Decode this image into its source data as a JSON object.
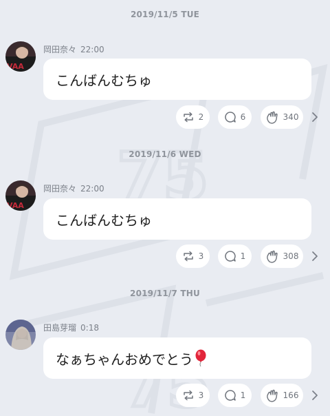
{
  "colors": {
    "background": "#e9ecf2",
    "bubble": "#ffffff",
    "meta_text": "#8f949c"
  },
  "posts": [
    {
      "date": "2019/11/5 TUE",
      "author": "岡田奈々",
      "time": "22:00",
      "avatar": "avatar-photo-okada",
      "message": "こんばんむちゅ",
      "reposts": "2",
      "comments": "6",
      "claps": "340"
    },
    {
      "date": "2019/11/6 WED",
      "author": "岡田奈々",
      "time": "22:00",
      "avatar": "avatar-photo-okada",
      "message": "こんばんむちゅ",
      "reposts": "3",
      "comments": "1",
      "claps": "308"
    },
    {
      "date": "2019/11/7 THU",
      "author": "田島芽瑠",
      "time": "0:18",
      "avatar": "avatar-photo-tajima",
      "message": "なぁちゃんおめでとう",
      "emoji": "balloon-icon",
      "reposts": "3",
      "comments": "1",
      "claps": "166"
    }
  ]
}
